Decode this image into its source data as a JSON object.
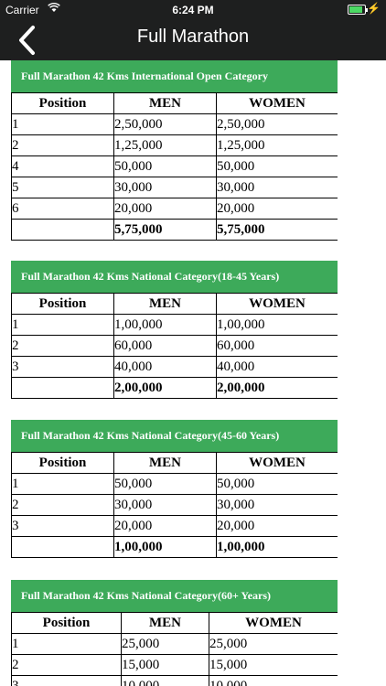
{
  "status_bar": {
    "carrier": "Carrier",
    "time": "6:24 PM"
  },
  "header": {
    "title": "Full Marathon"
  },
  "columns": {
    "position": "Position",
    "men": "MEN",
    "women": "WOMEN"
  },
  "sections": [
    {
      "title": "Full Marathon 42 Kms International Open Category",
      "rows": [
        {
          "position": "1",
          "men": "2,50,000",
          "women": "2,50,000"
        },
        {
          "position": "2",
          "men": "1,25,000",
          "women": "1,25,000"
        },
        {
          "position": "4",
          "men": "50,000",
          "women": "50,000"
        },
        {
          "position": "5",
          "men": "30,000",
          "women": "30,000"
        },
        {
          "position": "6",
          "men": "20,000",
          "women": "20,000"
        }
      ],
      "total": {
        "men": "5,75,000",
        "women": "5,75,000"
      }
    },
    {
      "title": "Full Marathon 42 Kms National Category(18-45 Years)",
      "rows": [
        {
          "position": "1",
          "men": "1,00,000",
          "women": "1,00,000"
        },
        {
          "position": "2",
          "men": "60,000",
          "women": "60,000"
        },
        {
          "position": "3",
          "men": "40,000",
          "women": "40,000"
        }
      ],
      "total": {
        "men": "2,00,000",
        "women": "2,00,000"
      }
    },
    {
      "title": "Full Marathon 42 Kms National Category(45-60 Years)",
      "rows": [
        {
          "position": "1",
          "men": "50,000",
          "women": "50,000"
        },
        {
          "position": "2",
          "men": "30,000",
          "women": "30,000"
        },
        {
          "position": "3",
          "men": "20,000",
          "women": "20,000"
        }
      ],
      "total": {
        "men": "1,00,000",
        "women": "1,00,000"
      }
    },
    {
      "title": "Full Marathon 42 Kms National Category(60+ Years)",
      "rows": [
        {
          "position": "1",
          "men": "25,000",
          "women": "25,000"
        },
        {
          "position": "2",
          "men": "15,000",
          "women": "15,000"
        },
        {
          "position": "3",
          "men": "10,000",
          "women": "10,000"
        }
      ]
    }
  ]
}
